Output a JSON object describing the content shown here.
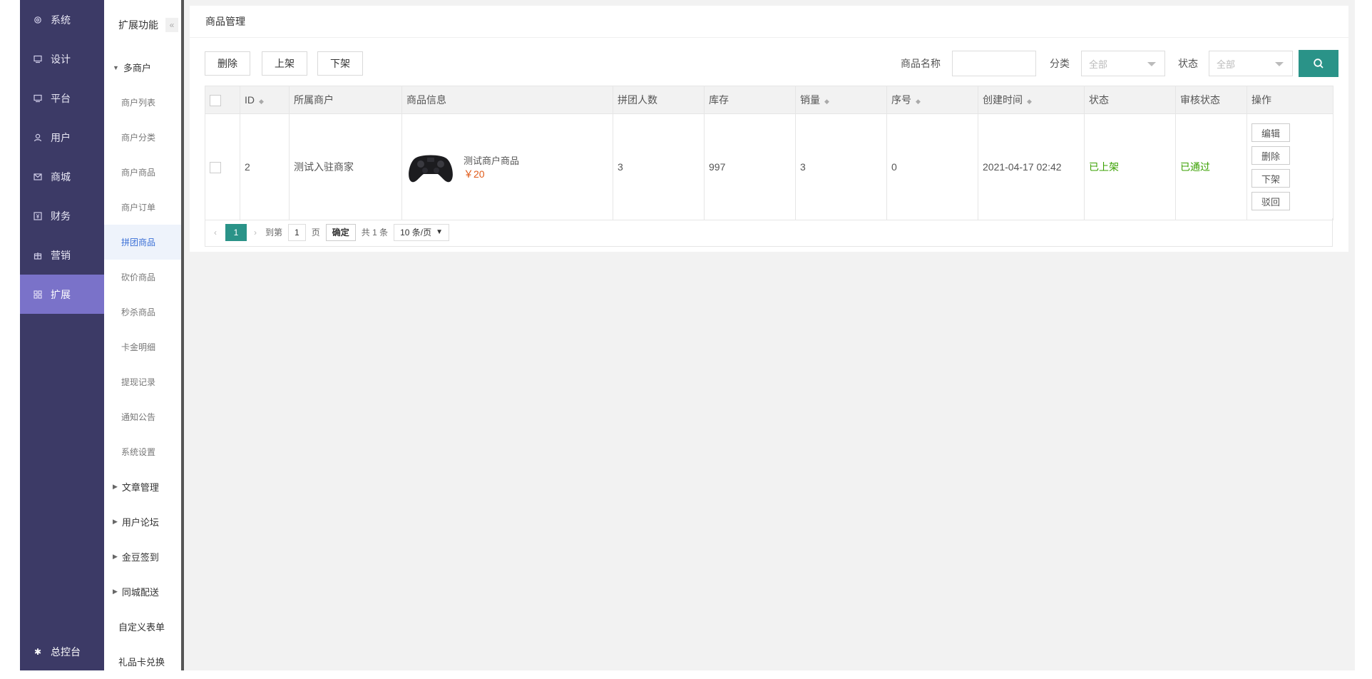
{
  "nav1": {
    "items": [
      {
        "label": "系统",
        "icon": "gear-icon"
      },
      {
        "label": "设计",
        "icon": "monitor-icon"
      },
      {
        "label": "平台",
        "icon": "monitor-icon"
      },
      {
        "label": "用户",
        "icon": "user-icon"
      },
      {
        "label": "商城",
        "icon": "mail-icon"
      },
      {
        "label": "财务",
        "icon": "money-icon"
      },
      {
        "label": "营销",
        "icon": "gift-icon"
      },
      {
        "label": "扩展",
        "icon": "grid-icon"
      }
    ],
    "active_index": 7,
    "bottom": {
      "label": "总控台",
      "icon": "gear-icon"
    }
  },
  "nav2": {
    "title": "扩展功能",
    "collapse_icon": "«",
    "group_open": "多商户",
    "subs": [
      "商户列表",
      "商户分类",
      "商户商品",
      "商户订单",
      "拼团商品",
      "砍价商品",
      "秒杀商品",
      "卡金明细",
      "提现记录",
      "通知公告",
      "系统设置"
    ],
    "active_sub": "拼团商品",
    "groups_closed": [
      "文章管理",
      "用户论坛",
      "金豆签到",
      "同城配送"
    ],
    "plain": [
      "自定义表单",
      "礼品卡兑换"
    ]
  },
  "page": {
    "title": "商品管理",
    "toolbar": {
      "delete": "删除",
      "on_shelf": "上架",
      "off_shelf": "下架"
    },
    "filters": {
      "name_label": "商品名称",
      "name_value": "",
      "category_label": "分类",
      "category_value": "全部",
      "status_label": "状态",
      "status_value": "全部"
    }
  },
  "table": {
    "headers": [
      "ID",
      "所属商户",
      "商品信息",
      "拼团人数",
      "库存",
      "销量",
      "序号",
      "创建时间",
      "状态",
      "审核状态",
      "操作"
    ],
    "rows": [
      {
        "id": "2",
        "merchant": "测试入驻商家",
        "product_name": "测试商户商品",
        "product_price": "￥20",
        "group_size": "3",
        "stock": "997",
        "sales": "3",
        "order": "0",
        "created": "2021-04-17 02:42",
        "status": "已上架",
        "audit": "已通过",
        "actions": [
          "编辑",
          "删除",
          "下架",
          "驳回"
        ]
      }
    ]
  },
  "pager": {
    "current": "1",
    "goto_label": "到第",
    "goto_value": "1",
    "page_unit": "页",
    "confirm": "确定",
    "total": "共 1 条",
    "per_page": "10 条/页"
  },
  "colors": {
    "sidebar": "#3c3a66",
    "active": "#7a72c9",
    "accent": "#2a9388",
    "success": "#39a000",
    "price": "#e05b1a"
  }
}
